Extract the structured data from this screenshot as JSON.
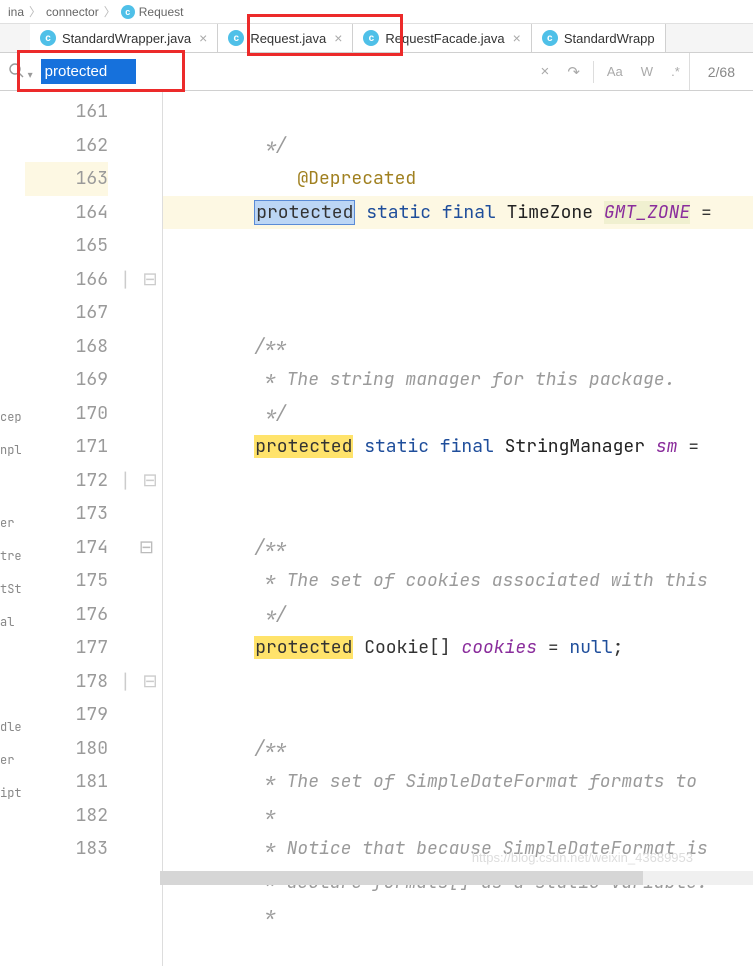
{
  "breadcrumb": {
    "a": "ina",
    "b": "connector",
    "c": "Request"
  },
  "tabs": [
    {
      "label": "StandardWrapper.java"
    },
    {
      "label": "Request.java"
    },
    {
      "label": "RequestFacade.java"
    },
    {
      "label": "StandardWrapp"
    }
  ],
  "search": {
    "value": "protected",
    "count": "2/68",
    "close": "×",
    "prev": "↷",
    "caseLbl": "Aa",
    "wordLbl": "W",
    "regexLbl": ".*"
  },
  "lines": {
    "start": 161,
    "nums": [
      "161",
      "162",
      "163",
      "164",
      "165",
      "166",
      "167",
      "168",
      "169",
      "170",
      "171",
      "172",
      "173",
      "174",
      "175",
      "176",
      "177",
      "178",
      "179",
      "180",
      "181",
      "182",
      "183"
    ]
  },
  "code": {
    "l1": "     */",
    "l2": "    @Deprecated",
    "l3_a": "protected",
    "l3_b": " static final ",
    "l3_c": "TimeZone ",
    "l3_d": "GMT_ZONE",
    "l3_e": " =",
    "l6": "    /**",
    "l7": "     * The string manager for this package.",
    "l8": "     */",
    "l9_a": "protected",
    "l9_b": " static final ",
    "l9_c": "StringManager ",
    "l9_d": "sm",
    "l9_e": " =",
    "l12": "    /**",
    "l13": "     * The set of cookies associated with this",
    "l14": "     */",
    "l15_a": "protected",
    "l15_b": " Cookie[] ",
    "l15_c": "cookies",
    "l15_d": " = ",
    "l15_e": "null",
    "l15_f": ";",
    "l18": "    /**",
    "l19": "     * The set of SimpleDateFormat formats to ",
    "l20": "     *",
    "l21": "     * Notice that because SimpleDateFormat is",
    "l22": "     * declare formats[] as a static variable.",
    "l23": "     *"
  },
  "leftpanel": {
    "a": "cep",
    "b": "npl",
    "c": "er",
    "d": "tre",
    "e": "tSt",
    "f": "al",
    "g": "dle",
    "h": "er",
    "i": "ipt"
  },
  "watermark": "https://blog.csdn.net/weixin_43689953"
}
